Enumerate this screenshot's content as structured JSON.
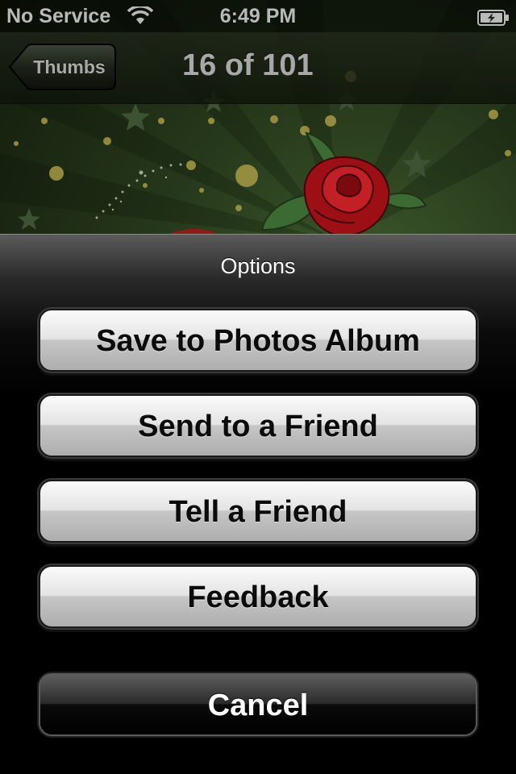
{
  "status_bar": {
    "carrier": "No Service",
    "time": "6:49 PM",
    "wifi_icon": "wifi-icon",
    "battery_icon": "battery-charging-icon"
  },
  "nav_bar": {
    "back_label": "Thumbs",
    "title": "16 of 101"
  },
  "action_sheet": {
    "title": "Options",
    "buttons": [
      {
        "label": "Save to Photos Album"
      },
      {
        "label": "Send to a Friend"
      },
      {
        "label": "Tell a Friend"
      },
      {
        "label": "Feedback"
      }
    ],
    "cancel_label": "Cancel"
  },
  "colors": {
    "wallpaper": "#26381b",
    "rose": "#a0151a",
    "sheet_background": "#000000"
  }
}
